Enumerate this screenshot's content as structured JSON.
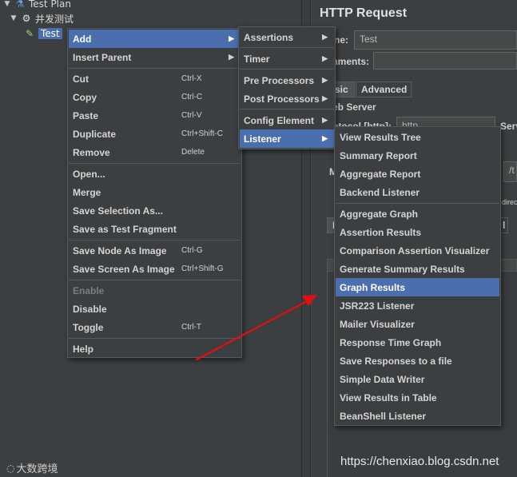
{
  "tree": {
    "test_plan": "Test Plan",
    "thread_group": "并发测试",
    "sampler": "Test"
  },
  "http_request": {
    "title": "HTTP Request",
    "name_label": "ne:",
    "name_value": "Test",
    "comments_label": "mments:",
    "tabs": [
      "sic",
      "Advanced"
    ],
    "web_server_label": "eb Server",
    "protocol_label": "otocol [http]:",
    "protocol_value": "http",
    "server_label": "Serv",
    "m_label": "M",
    "path_value": "/t",
    "redirect_label": "direc",
    "p_tab": "P",
    "l_tab": "l"
  },
  "context_menu": {
    "items": [
      {
        "label": "Add",
        "submenu": true
      },
      {
        "label": "Insert Parent",
        "submenu": true
      },
      {
        "label": "Cut",
        "accel": "Ctrl-X"
      },
      {
        "label": "Copy",
        "accel": "Ctrl-C"
      },
      {
        "label": "Paste",
        "accel": "Ctrl-V"
      },
      {
        "label": "Duplicate",
        "accel": "Ctrl+Shift-C"
      },
      {
        "label": "Remove",
        "accel": "Delete"
      },
      {
        "label": "Open..."
      },
      {
        "label": "Merge"
      },
      {
        "label": "Save Selection As..."
      },
      {
        "label": "Save as Test Fragment"
      },
      {
        "label": "Save Node As Image",
        "accel": "Ctrl-G"
      },
      {
        "label": "Save Screen As Image",
        "accel": "Ctrl+Shift-G"
      },
      {
        "label": "Enable"
      },
      {
        "label": "Disable"
      },
      {
        "label": "Toggle",
        "accel": "Ctrl-T"
      },
      {
        "label": "Help"
      }
    ]
  },
  "add_menu": {
    "items": [
      "Assertions",
      "Timer",
      "Pre Processors",
      "Post Processors",
      "Config Element",
      "Listener"
    ]
  },
  "listener_menu": {
    "items": [
      "View Results Tree",
      "Summary Report",
      "Aggregate Report",
      "Backend Listener",
      "Aggregate Graph",
      "Assertion Results",
      "Comparison Assertion Visualizer",
      "Generate Summary Results",
      "Graph Results",
      "JSR223 Listener",
      "Mailer Visualizer",
      "Response Time Graph",
      "Save Responses to a file",
      "Simple Data Writer",
      "View Results in Table",
      "BeanShell Listener"
    ]
  },
  "watermarks": {
    "left": "大数跨境",
    "right": "https://chenxiao.blog.csdn.net"
  },
  "colors": {
    "highlight": "#4b6eaf",
    "arrow": "#e01010",
    "background": "#3c3f41"
  }
}
